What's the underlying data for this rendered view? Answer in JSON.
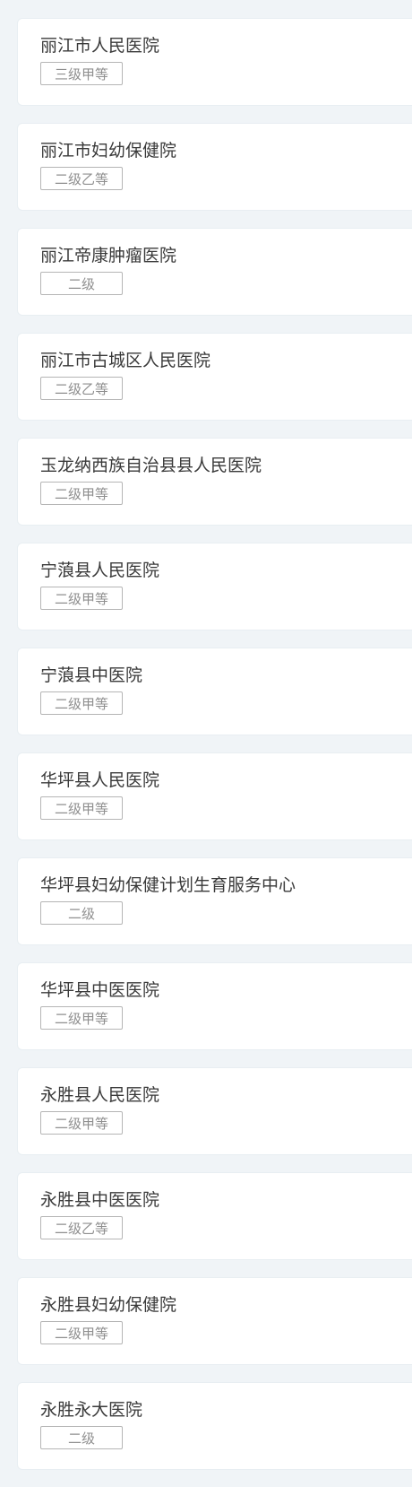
{
  "hospitals": [
    {
      "name": "丽江市人民医院",
      "level": "三级甲等"
    },
    {
      "name": "丽江市妇幼保健院",
      "level": "二级乙等"
    },
    {
      "name": "丽江帝康肿瘤医院",
      "level": "二级"
    },
    {
      "name": "丽江市古城区人民医院",
      "level": "二级乙等"
    },
    {
      "name": "玉龙纳西族自治县县人民医院",
      "level": "二级甲等"
    },
    {
      "name": "宁蒗县人民医院",
      "level": "二级甲等"
    },
    {
      "name": "宁蒗县中医院",
      "level": "二级甲等"
    },
    {
      "name": "华坪县人民医院",
      "level": "二级甲等"
    },
    {
      "name": "华坪县妇幼保健计划生育服务中心",
      "level": "二级"
    },
    {
      "name": "华坪县中医医院",
      "level": "二级甲等"
    },
    {
      "name": "永胜县人民医院",
      "level": "二级甲等"
    },
    {
      "name": "永胜县中医医院",
      "level": "二级乙等"
    },
    {
      "name": "永胜县妇幼保健院",
      "level": "二级甲等"
    },
    {
      "name": "永胜永大医院",
      "level": "二级"
    }
  ]
}
